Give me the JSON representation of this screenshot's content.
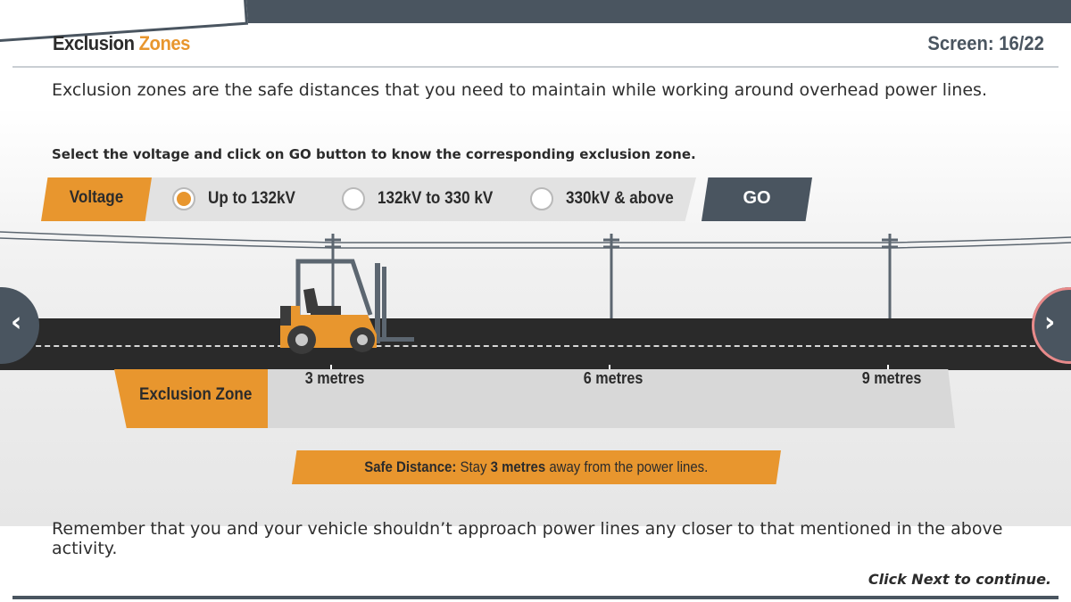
{
  "header": {
    "title_main": "Exclusion",
    "title_accent": "Zones",
    "screen_counter": "Screen: 16/22"
  },
  "intro": "Exclusion zones are the safe distances that you need to maintain while working around overhead power lines.",
  "instruction": "Select the voltage and click on GO button to know the corresponding exclusion zone.",
  "selector": {
    "label": "Voltage",
    "options": [
      {
        "label": "Up to 132kV",
        "selected": true
      },
      {
        "label": "132kV to 330 kV",
        "selected": false
      },
      {
        "label": "330kV & above",
        "selected": false
      }
    ],
    "go_label": "GO"
  },
  "zone": {
    "label": "Exclusion Zone",
    "distances": [
      "3 metres",
      "6 metres",
      "9 metres"
    ]
  },
  "safe_distance": {
    "prefix": "Safe Distance:",
    "text1": "Stay",
    "value": "3 metres",
    "text2": "away from the power lines."
  },
  "remember": "Remember that you and your vehicle shouldn’t approach power lines any closer to that mentioned in the above activity.",
  "footer": {
    "click_next": "Click Next to continue."
  },
  "colors": {
    "accent": "#e8962e",
    "slate": "#4a5560",
    "road": "#2a2a2a"
  }
}
